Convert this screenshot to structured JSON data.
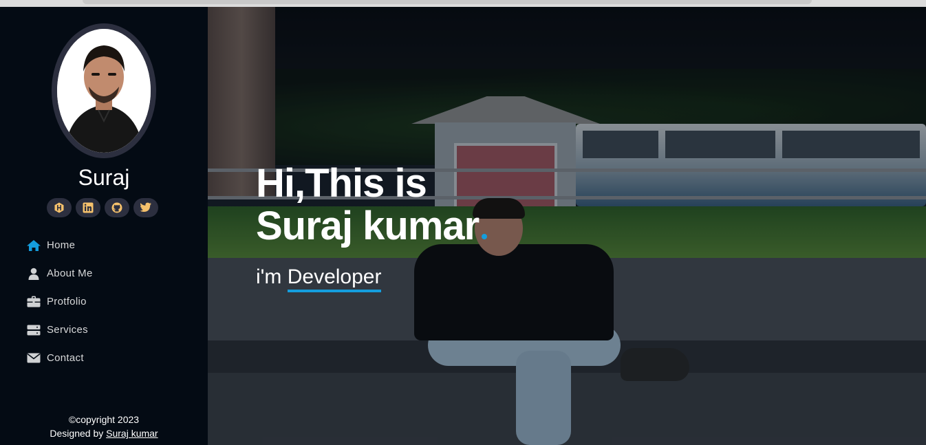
{
  "profile": {
    "name": "Suraj"
  },
  "socials": [
    {
      "name": "hashnode",
      "icon": "hashnode-icon"
    },
    {
      "name": "linkedin",
      "icon": "linkedin-icon"
    },
    {
      "name": "github",
      "icon": "github-icon"
    },
    {
      "name": "twitter",
      "icon": "twitter-icon"
    }
  ],
  "nav": {
    "items": [
      {
        "label": "Home",
        "icon": "home-icon",
        "active": true
      },
      {
        "label": "About Me",
        "icon": "user-icon"
      },
      {
        "label": "Protfolio",
        "icon": "briefcase-icon"
      },
      {
        "label": "Services",
        "icon": "server-icon"
      },
      {
        "label": "Contact",
        "icon": "envelope-icon"
      }
    ]
  },
  "footer": {
    "copyright": "©copyright 2023",
    "designed_by": "Designed by",
    "author_link": "Suraj kumar"
  },
  "hero": {
    "line1": "Hi,This is",
    "line2": "Suraj kumar",
    "prefix": "i'm",
    "role": "Developer"
  },
  "colors": {
    "accent": "#149ddd",
    "sidebar_bg": "#040b14",
    "social_bg": "#2c2f3f",
    "active_icon": "#149ddd"
  }
}
